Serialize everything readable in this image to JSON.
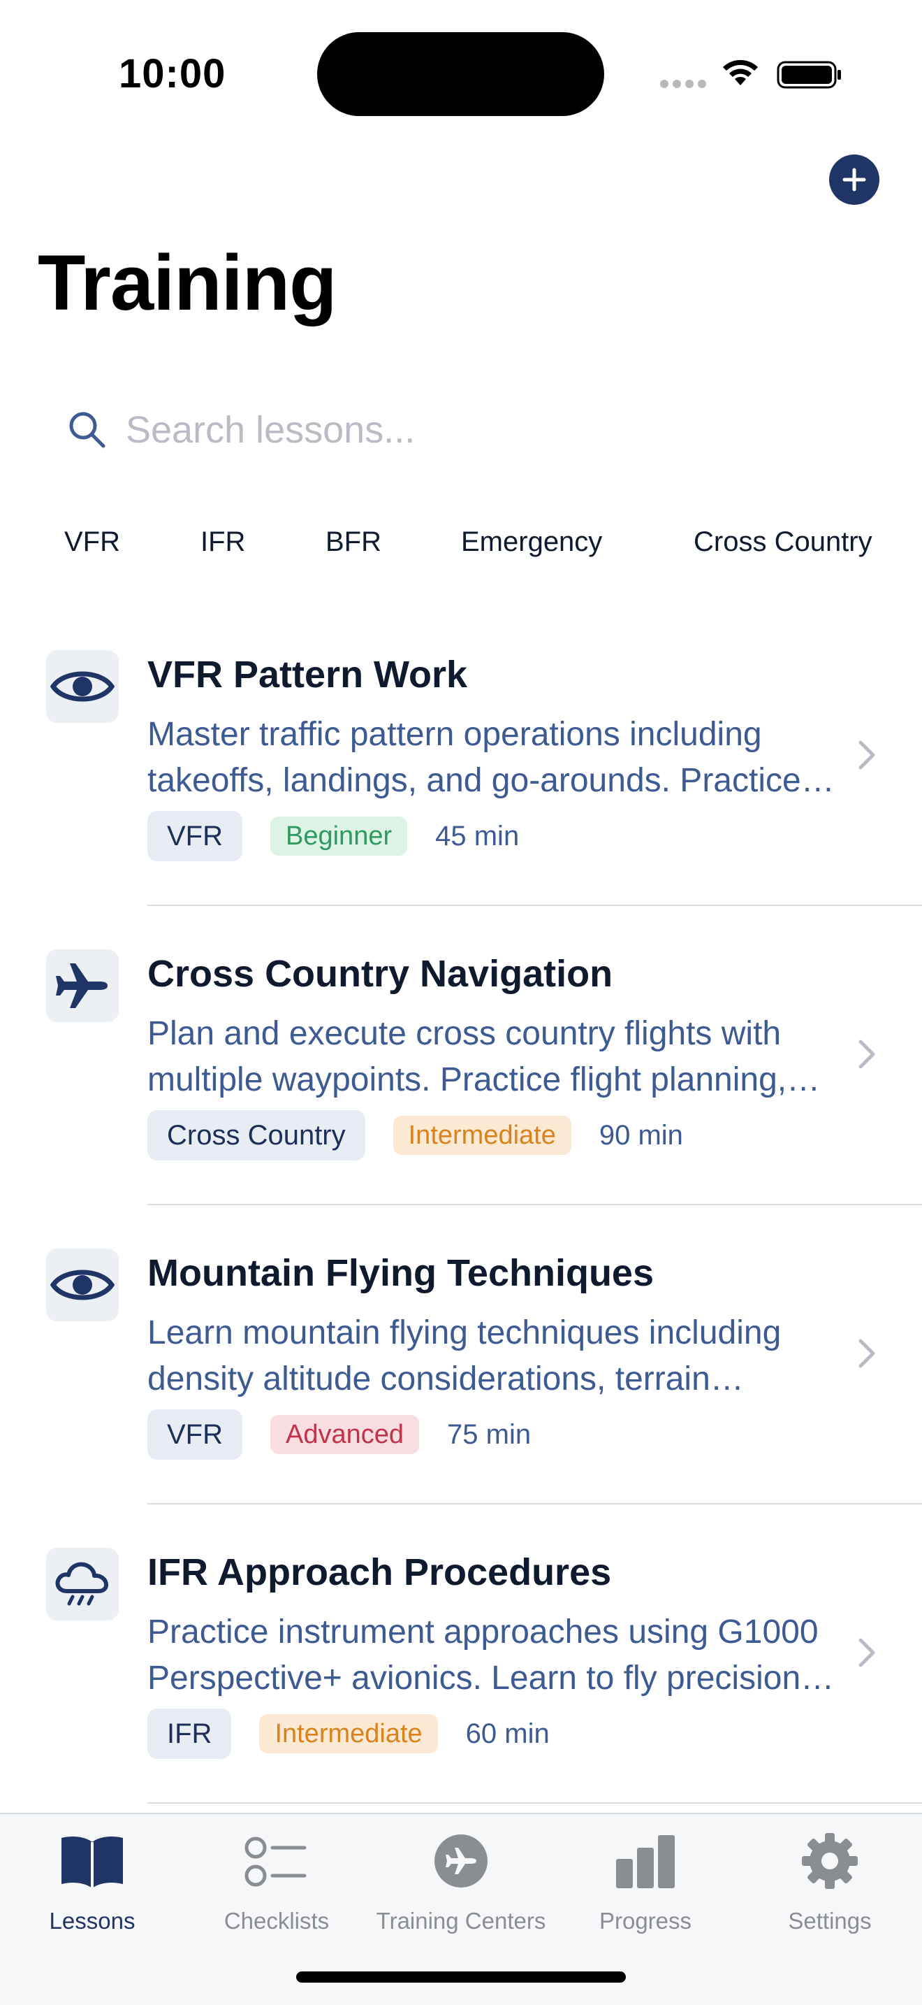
{
  "status_bar": {
    "time": "10:00"
  },
  "header": {
    "title": "Training"
  },
  "search": {
    "placeholder": "Search lessons..."
  },
  "filters": [
    "VFR",
    "IFR",
    "BFR",
    "Emergency",
    "Cross Country"
  ],
  "lessons": [
    {
      "icon": "eye-icon",
      "title": "VFR Pattern Work",
      "description": "Master traffic pattern operations including takeoffs, landings, and go-arounds. Practice normal, crosswind and short field landings.",
      "category": "VFR",
      "level": "Beginner",
      "duration": "45 min"
    },
    {
      "icon": "airplane-icon",
      "title": "Cross Country Navigation",
      "description": "Plan and execute cross country flights with multiple waypoints. Practice flight planning, pilotage and dead reckoning.",
      "category": "Cross Country",
      "level": "Intermediate",
      "duration": "90 min"
    },
    {
      "icon": "eye-icon",
      "title": "Mountain Flying Techniques",
      "description": "Learn mountain flying techniques including density altitude considerations, terrain awareness and route selection.",
      "category": "VFR",
      "level": "Advanced",
      "duration": "75 min"
    },
    {
      "icon": "cloud-rain-icon",
      "title": "IFR Approach Procedures",
      "description": "Practice instrument approaches using G1000 Perspective+ avionics. Learn to fly precision and non-precision approaches.",
      "category": "IFR",
      "level": "Intermediate",
      "duration": "60 min"
    }
  ],
  "level_colors": {
    "Beginner": {
      "bg": "#dcf3e6",
      "fg": "#2e9a5f"
    },
    "Intermediate": {
      "bg": "#fbe9d3",
      "fg": "#d9831f"
    },
    "Advanced": {
      "bg": "#f8dde1",
      "fg": "#c0334a"
    }
  },
  "tabs": [
    {
      "label": "Lessons",
      "icon": "book-icon",
      "active": true
    },
    {
      "label": "Checklists",
      "icon": "checklist-icon",
      "active": false
    },
    {
      "label": "Training Centers",
      "icon": "airplane-circle-icon",
      "active": false
    },
    {
      "label": "Progress",
      "icon": "bar-chart-icon",
      "active": false
    },
    {
      "label": "Settings",
      "icon": "gear-icon",
      "active": false
    }
  ],
  "colors": {
    "accent": "#1f3566",
    "text_secondary": "#3d5a93",
    "inactive": "#8a8d92"
  }
}
